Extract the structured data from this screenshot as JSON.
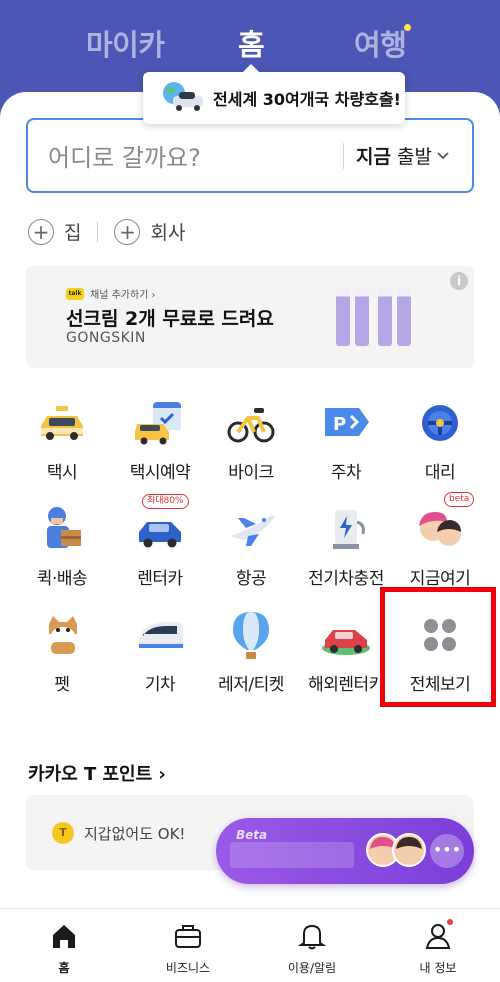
{
  "header": {
    "tabs": [
      {
        "label": "마이카",
        "active": false
      },
      {
        "label": "홈",
        "active": true
      },
      {
        "label": "여행",
        "active": false
      }
    ],
    "tooltip": "전세계 30여개국 차량호출!"
  },
  "search": {
    "placeholder": "어디로 갈까요?",
    "time_bold": "지금",
    "time_rest": " 출발"
  },
  "places": [
    {
      "label": "집"
    },
    {
      "label": "회사"
    }
  ],
  "ad": {
    "channel": "채널 추가하기 ›",
    "channel_logo": "talk",
    "title": "선크림 2개 무료로 드려요",
    "brand": "GONGSKIN",
    "info_icon": "i"
  },
  "services": [
    {
      "label": "택시"
    },
    {
      "label": "택시예약"
    },
    {
      "label": "바이크"
    },
    {
      "label": "주차"
    },
    {
      "label": "대리"
    },
    {
      "label": "퀵·배송"
    },
    {
      "label": "렌터카",
      "badge": "최대80%"
    },
    {
      "label": "항공"
    },
    {
      "label": "전기차충전"
    },
    {
      "label": "지금여기",
      "badge": "beta"
    },
    {
      "label": "펫"
    },
    {
      "label": "기차"
    },
    {
      "label": "레저/티켓"
    },
    {
      "label": "해외렌터카"
    },
    {
      "label": "전체보기"
    }
  ],
  "points": {
    "title": "카카오 T 포인트 ›",
    "coin": "T",
    "text": "지갑없어도 OK!"
  },
  "floating": {
    "beta": "Beta",
    "more": "•••"
  },
  "bottom_nav": [
    {
      "label": "홈",
      "active": true
    },
    {
      "label": "비즈니스"
    },
    {
      "label": "이용/알림"
    },
    {
      "label": "내 정보"
    }
  ],
  "colors": {
    "header_bg": "#4b56b5",
    "search_border": "#4b8ce8",
    "highlight": "#f0000a",
    "pill": "#8a4de0"
  }
}
